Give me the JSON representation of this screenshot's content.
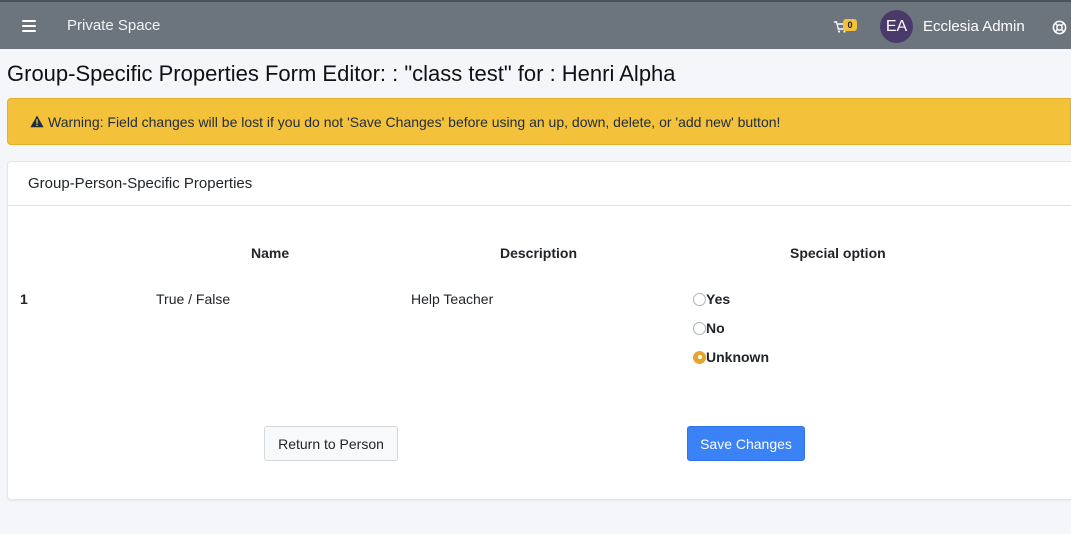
{
  "topbar": {
    "brand": "Private Space",
    "cart_count": "0",
    "avatar_initials": "EA",
    "username": "Ecclesia Admin"
  },
  "page": {
    "title": "Group-Specific Properties Form Editor: : \"class test\" for : Henri Alpha"
  },
  "alert": {
    "text": "Warning: Field changes will be lost if you do not 'Save Changes' before using an up, down, delete, or 'add new' button!"
  },
  "card": {
    "header": "Group-Person-Specific Properties",
    "columns": {
      "name": "Name",
      "description": "Description",
      "special": "Special option"
    },
    "rows": [
      {
        "num": "1",
        "name": "True / False",
        "description": "Help Teacher",
        "options": [
          {
            "label": "Yes",
            "checked": false
          },
          {
            "label": "No",
            "checked": false
          },
          {
            "label": "Unknown",
            "checked": true
          }
        ]
      }
    ],
    "return_label": "Return to Person",
    "save_label": "Save Changes"
  },
  "colors": {
    "topbar": "#6c757d",
    "warning": "#f3c13a",
    "primary": "#3a82f6",
    "radio_checked": "#e3a62f"
  }
}
